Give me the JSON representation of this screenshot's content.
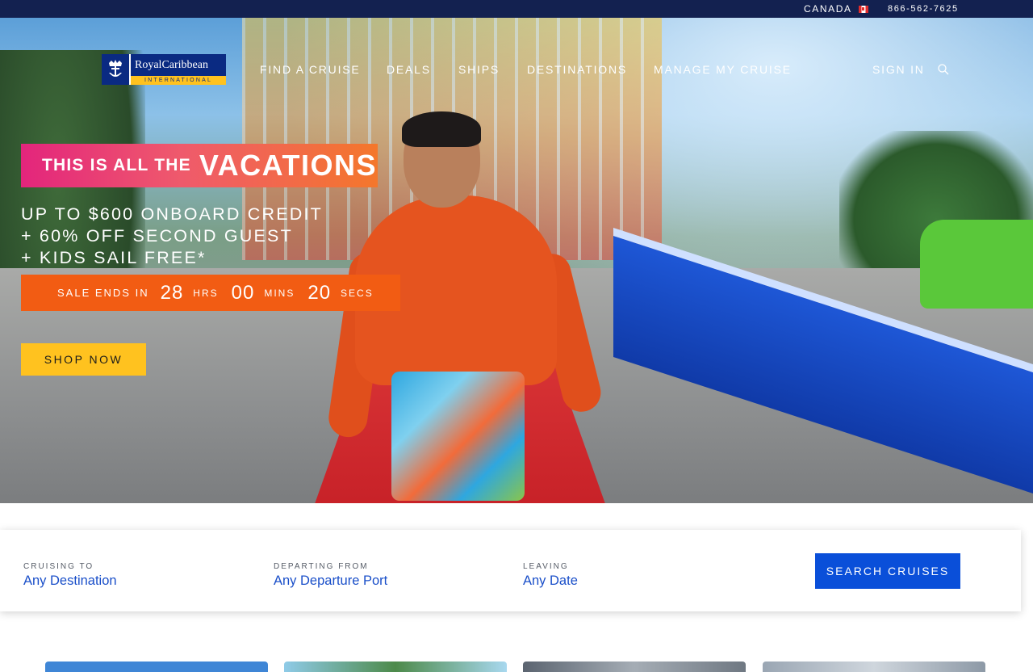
{
  "topbar": {
    "country": "CANADA",
    "phone": "866-562-7625"
  },
  "logo": {
    "brand": "RoyalCaribbean",
    "tagline": "INTERNATIONAL"
  },
  "nav": {
    "items": [
      {
        "label": "FIND A CRUISE"
      },
      {
        "label": "DEALS"
      },
      {
        "label": "SHIPS"
      },
      {
        "label": "DESTINATIONS"
      },
      {
        "label": "MANAGE MY CRUISE"
      }
    ],
    "sign_in": "SIGN IN"
  },
  "hero": {
    "badge_small": "THIS IS ALL THE",
    "badge_big": "VACATIONS",
    "offer_lines": [
      "UP TO $600 ONBOARD CREDIT",
      "+ 60% OFF SECOND GUEST",
      "+ KIDS SAIL FREE*"
    ],
    "countdown": {
      "label": "SALE ENDS IN",
      "hours": "28",
      "hours_unit": "HRS",
      "minutes": "00",
      "minutes_unit": "MINS",
      "seconds": "20",
      "seconds_unit": "SECS"
    },
    "cta": "SHOP NOW"
  },
  "search": {
    "fields": [
      {
        "caption": "CRUISING TO",
        "value": "Any Destination"
      },
      {
        "caption": "DEPARTING FROM",
        "value": "Any Departure Port"
      },
      {
        "caption": "LEAVING",
        "value": "Any Date"
      }
    ],
    "button": "SEARCH CRUISES"
  },
  "colors": {
    "topbar": "#132150",
    "brand_navy": "#0a2a82",
    "accent_yellow": "#ffc21f",
    "timer_orange": "#f25c13",
    "search_blue": "#0a4fd9",
    "link_blue": "#1a4fc9"
  },
  "icons": {
    "flag": "canada-flag-icon",
    "search": "search-icon",
    "logo": "anchor-crown-icon"
  }
}
